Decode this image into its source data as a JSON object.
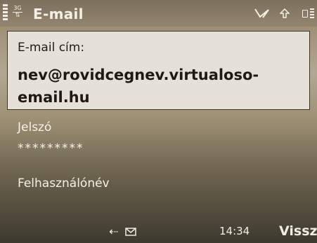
{
  "status_bar": {
    "network": "3G",
    "title": "E-mail",
    "icons": [
      "signal-strength-icon",
      "network-3g-icon",
      "msg-send-icon",
      "upload-arrow-icon",
      "battery-icon"
    ]
  },
  "form": {
    "email": {
      "label": "E-mail cím:",
      "value": "nev@rovidcegnev.virtualoso-email.hu"
    },
    "password": {
      "label": "Jelszó",
      "value": "*********"
    },
    "username": {
      "label": "Felhasználónév",
      "value": ""
    }
  },
  "softkeys": {
    "time": "14:34",
    "right_label": "Vissza",
    "icons": [
      "usb-icon",
      "envelope-icon"
    ]
  }
}
